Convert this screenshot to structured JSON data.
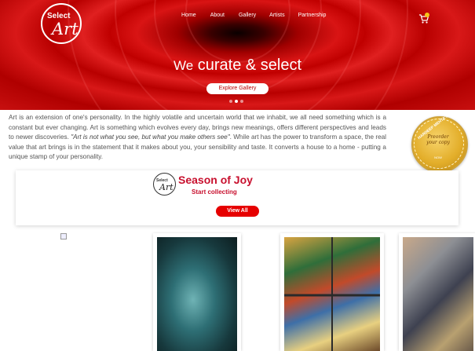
{
  "brand": {
    "logo_top": "Select",
    "logo_bottom": "Art"
  },
  "nav": {
    "items": [
      "Home",
      "About",
      "Gallery",
      "Artists",
      "Partnership"
    ]
  },
  "hero": {
    "headline_we": "We",
    "headline_rest": "curate & select",
    "cta": "Explore Gallery",
    "slides_total": 3,
    "slide_active": 2
  },
  "intro": {
    "part1": "Art is an extension of one's personality. In the highly volatile and uncertain world that we inhabit, we all need something which is a constant but ever changing. Art is something which evolves every day, brings new meanings, offers different perspectives and leads to newer discoveries. ",
    "quote": "\"Art is not what you see, but what you make others see\"",
    "part2": ". While art has the power to transform a space, the real value that art brings is in the statement that it makes about you, your sensibility and taste. It converts a house to a home - putting a unique stamp of your personality."
  },
  "badge": {
    "ribbon": "HARDEEP MEHTA'S",
    "main": "Preorder your copy",
    "sub": "NOW"
  },
  "season": {
    "logo_top": "Select",
    "logo_bottom": "Art",
    "title": "Season of Joy",
    "subtitle": "Start collecting",
    "button": "View All"
  },
  "colors": {
    "brand_red": "#c8102e",
    "button_red": "#e60000",
    "badge_gold": "#e3ae2a"
  }
}
